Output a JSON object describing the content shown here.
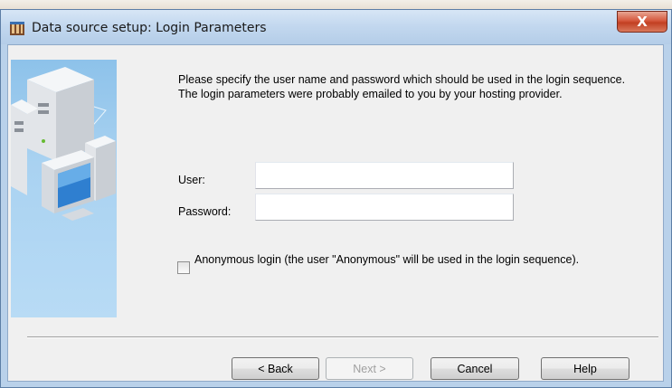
{
  "window": {
    "title": "Data source setup: Login Parameters",
    "close_glyph": "X"
  },
  "intro_text": "Please specify the user name and password which should be used in the login sequence. The login parameters were probably emailed to you by your hosting provider.",
  "fields": {
    "user": {
      "label": "User:",
      "value": "",
      "placeholder": ""
    },
    "password": {
      "label": "Password:",
      "value": "",
      "placeholder": ""
    }
  },
  "anonymous": {
    "checked": false,
    "label": "Anonymous login (the user \"Anonymous\" will be used in the login sequence)."
  },
  "buttons": {
    "back": "< Back",
    "next": "Next >",
    "cancel": "Cancel",
    "help": "Help"
  },
  "icons": {
    "app": "wizard-app-icon",
    "close": "close-icon",
    "side_art": "servers-computer-illustration"
  },
  "colors": {
    "titlebar": "#c3d8ef",
    "close_button": "#c94a2e",
    "side_panel": "#a9d2f1",
    "client_bg": "#f0f0f0"
  }
}
